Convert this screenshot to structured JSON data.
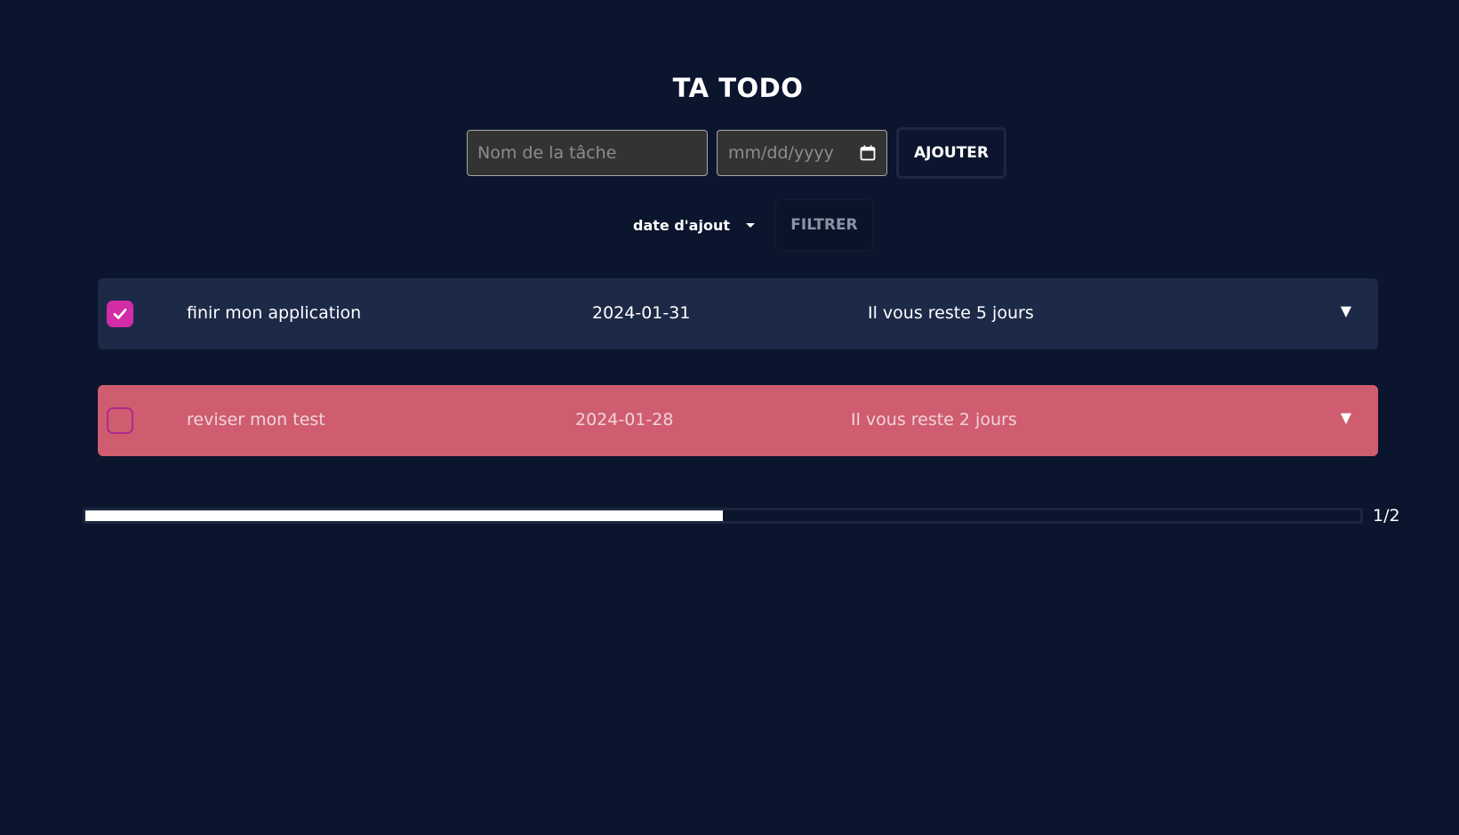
{
  "app": {
    "title": "TA TODO"
  },
  "form": {
    "task_placeholder": "Nom de la tâche",
    "date_placeholder": "mm/dd/yyyy",
    "add_label": "AJOUTER"
  },
  "filter": {
    "sort_value": "date d'ajout",
    "filter_label": "FILTRER"
  },
  "tasks": [
    {
      "name": "finir mon application",
      "date": "2024-01-31",
      "remaining": "Il vous reste 5 jours",
      "done": true,
      "status_color": "#1c2a48"
    },
    {
      "name": "reviser mon test",
      "date": "2024-01-28",
      "remaining": "Il vous reste 2 jours",
      "done": false,
      "status_color": "#cf5d6f"
    }
  ],
  "progress": {
    "completed": 1,
    "total": 2,
    "fraction": 0.5,
    "label": "1/2"
  },
  "colors": {
    "background": "#0b152d",
    "accent": "#d22ca6",
    "late": "#cf5d6f"
  },
  "icons": {
    "calendar": "calendar-icon",
    "caret": "caret-down-icon",
    "check": "check-icon",
    "expand": "triangle-down-icon"
  }
}
